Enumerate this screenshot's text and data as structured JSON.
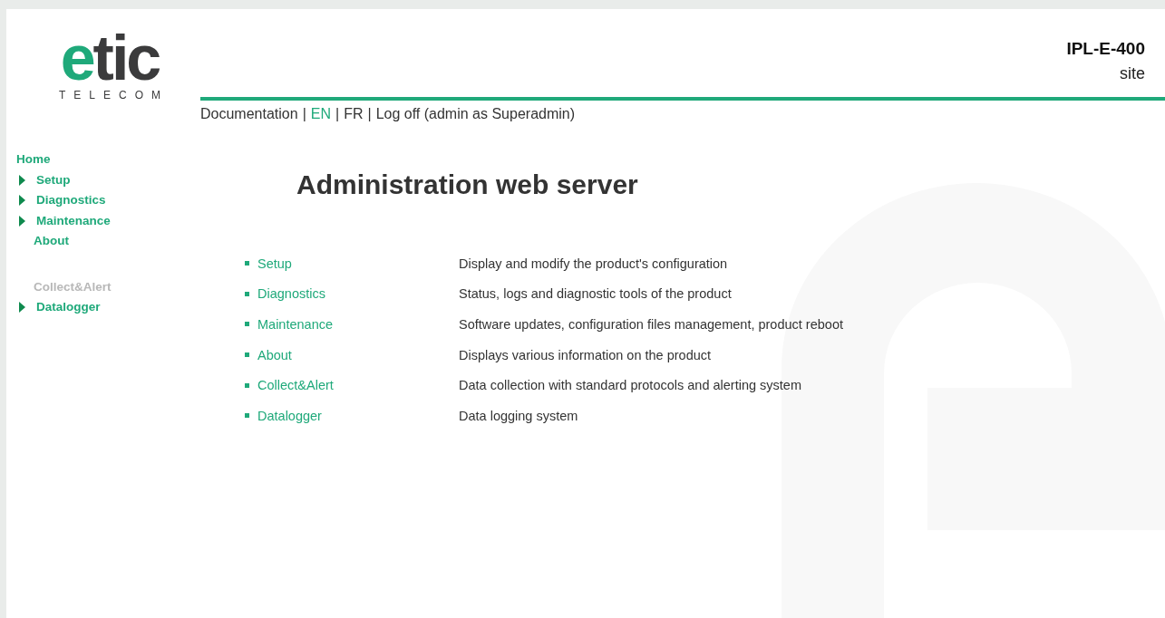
{
  "logo": {
    "accent": "e",
    "word": "tic",
    "tagline": "TELECOM"
  },
  "device": {
    "model": "IPL-E-400",
    "site": "site"
  },
  "top_links": {
    "separator": "|",
    "items": [
      {
        "label": "Documentation",
        "selected": false
      },
      {
        "label": "EN",
        "selected": true
      },
      {
        "label": "FR",
        "selected": false
      },
      {
        "label": "Log off (admin as Superadmin)",
        "selected": false
      }
    ]
  },
  "sidebar": {
    "items": [
      {
        "label": "Home",
        "kind": "top"
      },
      {
        "label": "Setup",
        "kind": "item",
        "expandable": true
      },
      {
        "label": "Diagnostics",
        "kind": "item",
        "expandable": true
      },
      {
        "label": "Maintenance",
        "kind": "item",
        "expandable": true
      },
      {
        "label": "About",
        "kind": "item",
        "expandable": false
      },
      {
        "label": "Collect&Alert",
        "kind": "section"
      },
      {
        "label": "Datalogger",
        "kind": "item",
        "expandable": true
      }
    ]
  },
  "heading": "Administration web server",
  "sections": [
    {
      "label": "Setup",
      "description": "Display and modify the product's configuration"
    },
    {
      "label": "Diagnostics",
      "description": "Status, logs and diagnostic tools of the product"
    },
    {
      "label": "Maintenance",
      "description": "Software updates, configuration files management, product reboot"
    },
    {
      "label": "About",
      "description": "Displays various information on the product"
    },
    {
      "label": "Collect&Alert",
      "description": "Data collection with standard protocols and alerting system"
    },
    {
      "label": "Datalogger",
      "description": "Data logging system"
    }
  ]
}
